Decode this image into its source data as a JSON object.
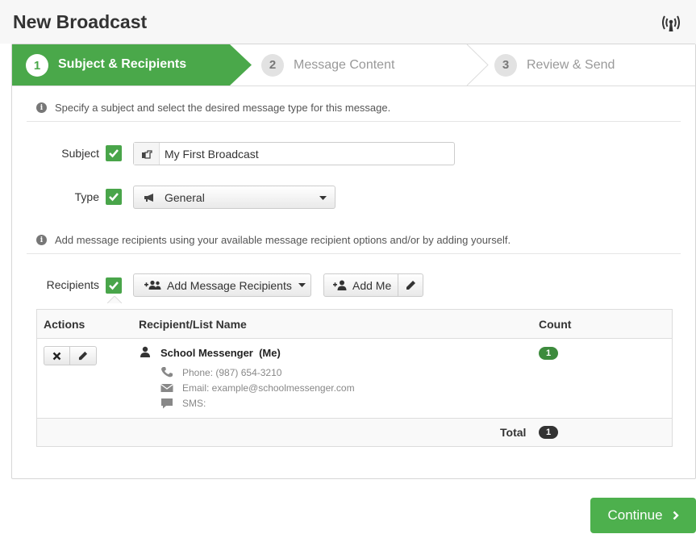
{
  "header": {
    "title": "New Broadcast",
    "icon": "broadcast-icon"
  },
  "wizard": {
    "steps": [
      {
        "num": "1",
        "label": "Subject & Recipients",
        "state": "active"
      },
      {
        "num": "2",
        "label": "Message Content",
        "state": "inactive"
      },
      {
        "num": "3",
        "label": "Review & Send",
        "state": "inactive"
      }
    ]
  },
  "info": {
    "subject_hint": "Specify a subject and select the desired message type for this message.",
    "recipients_hint": "Add message recipients using your available message recipient options and/or by adding yourself."
  },
  "form": {
    "subject_label": "Subject",
    "subject_value": "My First Broadcast",
    "type_label": "Type",
    "type_value": "General",
    "recipients_label": "Recipients"
  },
  "buttons": {
    "add_recipients": "Add Message Recipients",
    "add_me": "Add Me",
    "continue": "Continue"
  },
  "table": {
    "headers": {
      "actions": "Actions",
      "name": "Recipient/List Name",
      "count": "Count"
    },
    "rows": [
      {
        "name": "School Messenger  (Me)",
        "phone": "Phone: (987) 654-3210",
        "email": "Email: example@schoolmessenger.com",
        "sms": "SMS:",
        "count": "1"
      }
    ],
    "total_label": "Total",
    "total_value": "1"
  },
  "colors": {
    "accent": "#4aa84a",
    "badge_green": "#3d8b3d",
    "badge_dark": "#333333"
  }
}
